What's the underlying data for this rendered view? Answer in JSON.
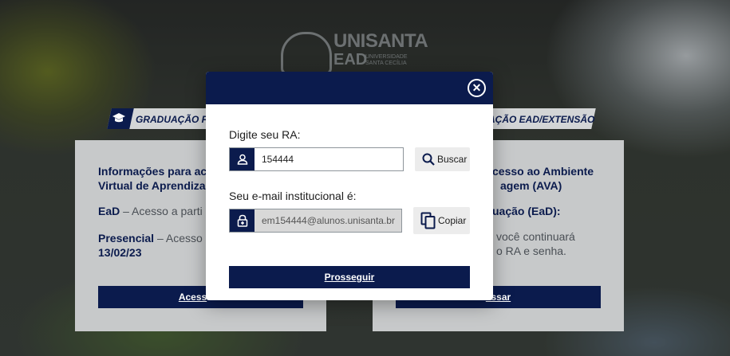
{
  "brand": {
    "name": "UNISANTA",
    "sub": "EAD",
    "tagline": "UNIVERSIDADE SANTA CECÍLIA"
  },
  "background": {
    "tab_left": "GRADUAÇÃO P",
    "tab_right": "AÇÃO EAD/EXTENSÃO",
    "left_card": {
      "heading_1": "Informações para ace",
      "heading_2": "Virtual de Aprendiza",
      "ead_label": "EaD",
      "ead_text": " – Acesso a parti",
      "presencial_label": "Presencial",
      "presencial_text": " – Acesso",
      "presencial_date": "13/02/23",
      "button": "Acess"
    },
    "right_card": {
      "heading_1": "cesso ao Ambiente",
      "heading_2": "agem (AVA)",
      "line_1": "uação (EaD):",
      "line_2": "você continuará",
      "line_3": "o RA e senha.",
      "button": "essar"
    }
  },
  "modal": {
    "close_icon": "close-icon",
    "ra_label": "Digite seu RA:",
    "ra_value": "154444",
    "search_label": "Buscar",
    "email_label": "Seu e-mail institucional é:",
    "email_value": "em154444@alunos.unisanta.br",
    "copy_label": "Copiar",
    "submit_label": "Prosseguir"
  },
  "colors": {
    "primary": "#0b1b4d",
    "button_bg": "#ececec",
    "readonly_bg": "#d8d8d8"
  }
}
